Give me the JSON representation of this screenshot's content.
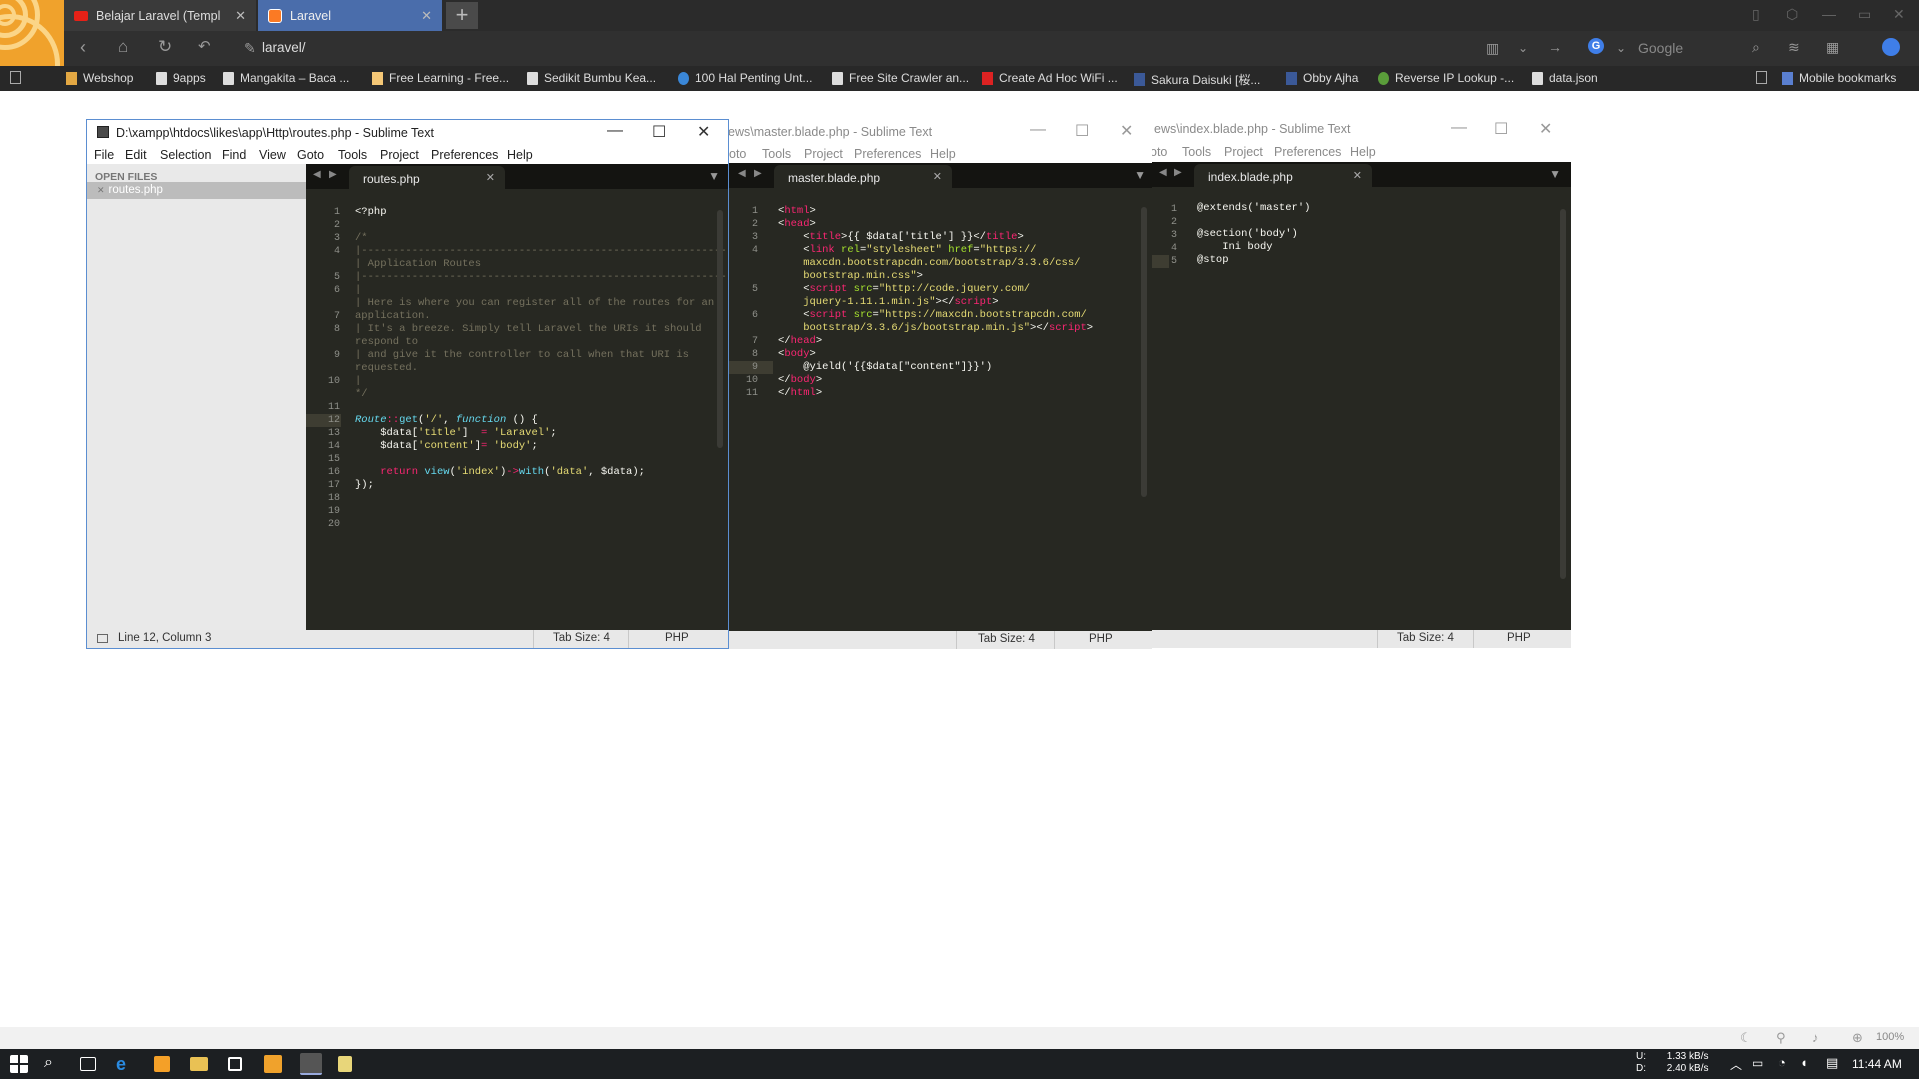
{
  "browser": {
    "tabs": [
      {
        "title": "Belajar Laravel (Templ",
        "active": false
      },
      {
        "title": "Laravel",
        "active": true
      }
    ],
    "address": "laravel/",
    "search_placeholder": "Google",
    "bookmarks": [
      "Webshop",
      "9apps",
      "Mangakita – Baca ...",
      "Free Learning - Free...",
      "Sedikit Bumbu Kea...",
      "100 Hal Penting Unt...",
      "Free Site Crawler an...",
      "Create Ad Hoc WiFi ...",
      "Sakura Daisuki [桜...",
      "Obby Ajha",
      "Reverse IP Lookup -...",
      "data.json"
    ],
    "mobile_bookmarks": "Mobile bookmarks"
  },
  "editor_windows": [
    {
      "title": "D:\\xampp\\htdocs\\likes\\app\\Http\\routes.php - Sublime Text",
      "menu": [
        "File",
        "Edit",
        "Selection",
        "Find",
        "View",
        "Goto",
        "Tools",
        "Project",
        "Preferences",
        "Help"
      ],
      "sidebar_header": "OPEN FILES",
      "open_file": "routes.php",
      "tab": "routes.php",
      "status_left": "Line 12, Column 3",
      "tab_size": "Tab Size: 4",
      "syntax": "PHP"
    },
    {
      "title": "ews\\master.blade.php - Sublime Text",
      "menu": [
        "oto",
        "Tools",
        "Project",
        "Preferences",
        "Help"
      ],
      "tab": "master.blade.php",
      "tab_size": "Tab Size: 4",
      "syntax": "PHP"
    },
    {
      "title": "ews\\index.blade.php - Sublime Text",
      "menu": [
        "oto",
        "Tools",
        "Project",
        "Preferences",
        "Help"
      ],
      "tab": "index.blade.php",
      "tab_size": "Tab Size: 4",
      "syntax": "PHP"
    }
  ],
  "routes_code": [
    [
      [
        "pl",
        "<?php"
      ]
    ],
    [],
    [
      [
        "cm",
        "/*"
      ]
    ],
    [
      [
        "cm",
        "|--------------------------------------------------------------------------"
      ]
    ],
    [
      [
        "cm",
        "| Application Routes"
      ]
    ],
    [
      [
        "cm",
        "|--------------------------------------------------------------------------"
      ]
    ],
    [
      [
        "cm",
        "|"
      ]
    ],
    [
      [
        "cm",
        "| Here is where you can register all of the routes for an"
      ]
    ],
    [
      [
        "cm",
        "application."
      ]
    ],
    [
      [
        "cm",
        "| It's a breeze. Simply tell Laravel the URIs it should"
      ]
    ],
    [
      [
        "cm",
        "respond to"
      ]
    ],
    [
      [
        "cm",
        "| and give it the controller to call when that URI is"
      ]
    ],
    [
      [
        "cm",
        "requested."
      ]
    ],
    [
      [
        "cm",
        "|"
      ]
    ],
    [
      [
        "cm",
        "*/"
      ]
    ],
    [],
    [
      [
        "ty",
        "Route"
      ],
      [
        "kw",
        "::"
      ],
      [
        "fn",
        "get"
      ],
      [
        "pl",
        "("
      ],
      [
        "st",
        "'/'"
      ],
      [
        "pl",
        ", "
      ],
      [
        "ty",
        "function"
      ],
      [
        "pl",
        " () {"
      ]
    ],
    [
      [
        "pl",
        "    $data["
      ],
      [
        "st",
        "'title'"
      ],
      [
        "pl",
        "]  "
      ],
      [
        "kw",
        "="
      ],
      [
        "pl",
        " "
      ],
      [
        "st",
        "'Laravel'"
      ],
      [
        "pl",
        ";"
      ]
    ],
    [
      [
        "pl",
        "    $data["
      ],
      [
        "st",
        "'content'"
      ],
      [
        "pl",
        "]"
      ],
      [
        "kw",
        "="
      ],
      [
        "pl",
        " "
      ],
      [
        "st",
        "'body'"
      ],
      [
        "pl",
        ";"
      ]
    ],
    [],
    [
      [
        "pl",
        "    "
      ],
      [
        "kw",
        "return"
      ],
      [
        "pl",
        " "
      ],
      [
        "fn",
        "view"
      ],
      [
        "pl",
        "("
      ],
      [
        "st",
        "'index'"
      ],
      [
        "pl",
        ")"
      ],
      [
        "kw",
        "->"
      ],
      [
        "fn",
        "with"
      ],
      [
        "pl",
        "("
      ],
      [
        "st",
        "'data'"
      ],
      [
        "pl",
        ", $data);"
      ]
    ],
    [
      [
        "pl",
        "});"
      ]
    ],
    []
  ],
  "routes_gutter": [
    "1",
    "2",
    "3",
    "4",
    "",
    "5",
    "6",
    "",
    "7",
    "8",
    "",
    "9",
    "",
    "10",
    "",
    "11",
    "12",
    "13",
    "14",
    "15",
    "16",
    "17",
    "18",
    "19",
    "20"
  ],
  "master_code": [
    [
      [
        "pl",
        "<"
      ],
      [
        "kw",
        "html"
      ],
      [
        "pl",
        ">"
      ]
    ],
    [
      [
        "pl",
        "<"
      ],
      [
        "kw",
        "head"
      ],
      [
        "pl",
        ">"
      ]
    ],
    [
      [
        "pl",
        "    <"
      ],
      [
        "kw",
        "title"
      ],
      [
        "pl",
        ">{{ $data['title'] }}</"
      ],
      [
        "kw",
        "title"
      ],
      [
        "pl",
        ">"
      ]
    ],
    [
      [
        "pl",
        "    <"
      ],
      [
        "kw",
        "link"
      ],
      [
        "pl",
        " "
      ],
      [
        "at",
        "rel"
      ],
      [
        "pl",
        "="
      ],
      [
        "st",
        "\"stylesheet\""
      ],
      [
        "pl",
        " "
      ],
      [
        "at",
        "href"
      ],
      [
        "pl",
        "="
      ],
      [
        "st",
        "\"https://"
      ]
    ],
    [
      [
        "st",
        "    maxcdn.bootstrapcdn.com/bootstrap/3.3.6/css/"
      ]
    ],
    [
      [
        "st",
        "    bootstrap.min.css\""
      ],
      [
        "pl",
        ">"
      ]
    ],
    [
      [
        "pl",
        "    <"
      ],
      [
        "kw",
        "script"
      ],
      [
        "pl",
        " "
      ],
      [
        "at",
        "src"
      ],
      [
        "pl",
        "="
      ],
      [
        "st",
        "\"http://code.jquery.com/"
      ]
    ],
    [
      [
        "st",
        "    jquery-1.11.1.min.js\""
      ],
      [
        "pl",
        "></"
      ],
      [
        "kw",
        "script"
      ],
      [
        "pl",
        ">"
      ]
    ],
    [
      [
        "pl",
        "    <"
      ],
      [
        "kw",
        "script"
      ],
      [
        "pl",
        " "
      ],
      [
        "at",
        "src"
      ],
      [
        "pl",
        "="
      ],
      [
        "st",
        "\"https://maxcdn.bootstrapcdn.com/"
      ]
    ],
    [
      [
        "st",
        "    bootstrap/3.3.6/js/bootstrap.min.js\""
      ],
      [
        "pl",
        "></"
      ],
      [
        "kw",
        "script"
      ],
      [
        "pl",
        ">"
      ]
    ],
    [
      [
        "pl",
        "</"
      ],
      [
        "kw",
        "head"
      ],
      [
        "pl",
        ">"
      ]
    ],
    [
      [
        "pl",
        "<"
      ],
      [
        "kw",
        "body"
      ],
      [
        "pl",
        ">"
      ]
    ],
    [
      [
        "pl",
        "    @yield('{{$data[\"content\"]}}')"
      ]
    ],
    [
      [
        "pl",
        "</"
      ],
      [
        "kw",
        "body"
      ],
      [
        "pl",
        ">"
      ]
    ],
    [
      [
        "pl",
        "</"
      ],
      [
        "kw",
        "html"
      ],
      [
        "pl",
        ">"
      ]
    ]
  ],
  "master_gutter": [
    "1",
    "2",
    "3",
    "4",
    "",
    "",
    "5",
    "",
    "6",
    "",
    "7",
    "8",
    "9",
    "10",
    "11"
  ],
  "index_code": [
    [
      [
        "pl",
        "@extends('master')"
      ]
    ],
    [],
    [
      [
        "pl",
        "@section('body')"
      ]
    ],
    [
      [
        "pl",
        "    Ini body"
      ]
    ],
    [
      [
        "pl",
        "@stop"
      ]
    ]
  ],
  "index_gutter": [
    "1",
    "2",
    "3",
    "4",
    "5"
  ],
  "taskbar": {
    "upload": "1.33 kB/s",
    "download": "2.40 kB/s",
    "up_label": "U:",
    "down_label": "D:",
    "clock": "11:44 AM",
    "zoom": "100%"
  },
  "colors": {
    "browser_active_tab": "#4a6dab",
    "sublime_bg": "#272822",
    "logo": "#f0a22c"
  }
}
